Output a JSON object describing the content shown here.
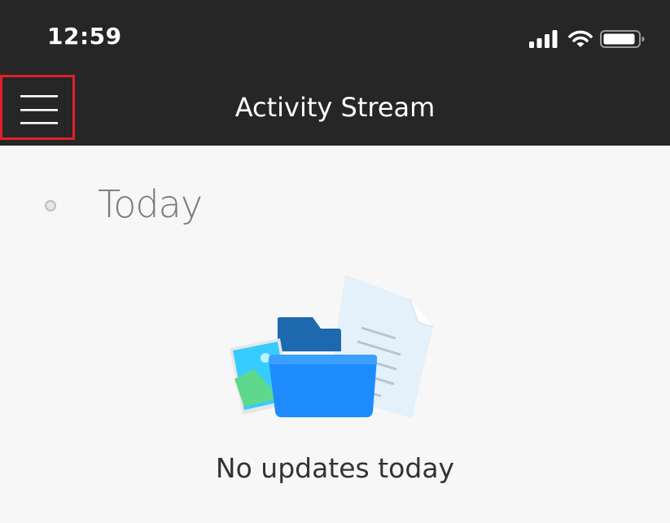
{
  "status_bar": {
    "time": "12:59",
    "icons": [
      "signal-icon",
      "wifi-icon",
      "battery-icon"
    ]
  },
  "header": {
    "title": "Activity Stream",
    "menu_icon": "hamburger-menu-icon"
  },
  "timeline": {
    "section_label": "Today"
  },
  "empty_state": {
    "illustration": "files-folder-illustration",
    "message": "No updates today"
  },
  "colors": {
    "header_bg": "#262626",
    "page_bg": "#f7f7f7",
    "highlight": "#e0202a",
    "folder_blue": "#1e90ff"
  }
}
